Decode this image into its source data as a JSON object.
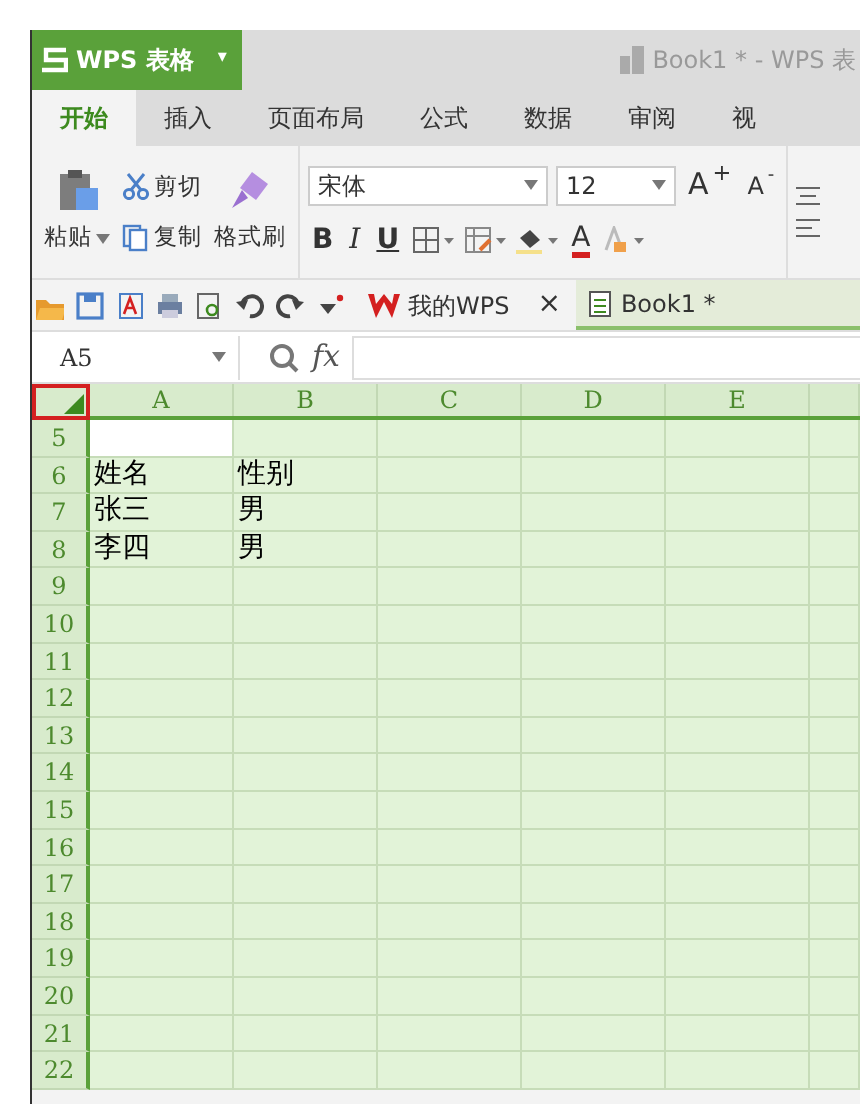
{
  "app_menu": {
    "label": "WPS 表格",
    "caret": "▾"
  },
  "title": "Book1 * - WPS 表",
  "tabs": [
    {
      "label": "开始",
      "selected": true
    },
    {
      "label": "插入",
      "selected": false
    },
    {
      "label": "页面布局",
      "selected": false
    },
    {
      "label": "公式",
      "selected": false
    },
    {
      "label": "数据",
      "selected": false
    },
    {
      "label": "审阅",
      "selected": false
    },
    {
      "label": "视",
      "selected": false
    }
  ],
  "clipboard": {
    "paste": "粘贴",
    "cut": "剪切",
    "copy": "复制",
    "painter": "格式刷"
  },
  "font": {
    "name": "宋体",
    "size": "12",
    "grow": "A$^{+}$",
    "shrink": "A$^{-}$",
    "bold": "B",
    "italic": "I",
    "underline": "U",
    "color_letter": "A"
  },
  "doc_tabs": [
    {
      "label": "我的WPS",
      "kind": "home",
      "selected": false,
      "close": "×"
    },
    {
      "label": "Book1 *",
      "kind": "sheet",
      "selected": true
    }
  ],
  "name_box": "A5",
  "fx": "fx",
  "columns": [
    "A",
    "B",
    "C",
    "D",
    "E"
  ],
  "rows": [
    {
      "number": "5",
      "selected": true
    },
    {
      "number": "6",
      "selected": false,
      "cells": [
        "姓名",
        "性别"
      ]
    },
    {
      "number": "7",
      "selected": false,
      "cells": [
        "张三",
        "男"
      ]
    },
    {
      "number": "8",
      "selected": false,
      "cells": [
        "李四",
        "男"
      ]
    },
    {
      "number": "9",
      "selected": false
    },
    {
      "number": "10",
      "selected": false
    },
    {
      "number": "11",
      "selected": false
    },
    {
      "number": "12",
      "selected": false
    },
    {
      "number": "13",
      "selected": false
    },
    {
      "number": "14",
      "selected": false
    },
    {
      "number": "15",
      "selected": false
    },
    {
      "number": "16",
      "selected": false
    },
    {
      "number": "17",
      "selected": false
    },
    {
      "number": "18",
      "selected": false
    },
    {
      "number": "19",
      "selected": false
    },
    {
      "number": "20",
      "selected": false
    },
    {
      "number": "21",
      "selected": false
    },
    {
      "number": "22",
      "selected": false
    }
  ]
}
